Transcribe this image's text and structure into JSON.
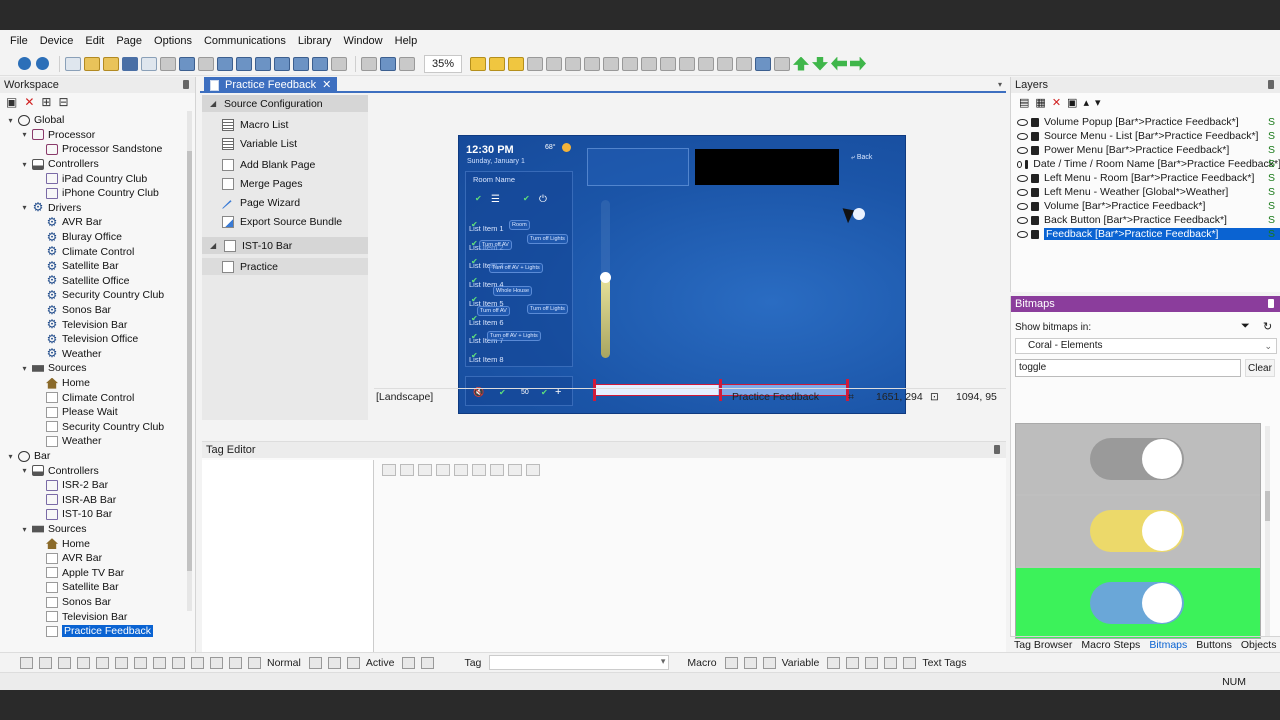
{
  "menu": [
    "File",
    "Device",
    "Edit",
    "Page",
    "Options",
    "Communications",
    "Library",
    "Window",
    "Help"
  ],
  "toolbar": {
    "zoom": "35%"
  },
  "workspace": {
    "title": "Workspace",
    "tree": [
      {
        "label": "Global",
        "icon": "globe",
        "level": 0,
        "tw": "▾"
      },
      {
        "label": "Processor",
        "icon": "proc",
        "level": 1,
        "tw": "▾"
      },
      {
        "label": "Processor Sandstone",
        "icon": "proc",
        "level": 2,
        "tw": ""
      },
      {
        "label": "Controllers",
        "icon": "ctrl",
        "level": 1,
        "tw": "▾"
      },
      {
        "label": "iPad Country Club",
        "icon": "dev",
        "level": 2,
        "tw": ""
      },
      {
        "label": "iPhone Country Club",
        "icon": "dev",
        "level": 2,
        "tw": ""
      },
      {
        "label": "Drivers",
        "icon": "gear",
        "level": 1,
        "tw": "▾"
      },
      {
        "label": "AVR Bar",
        "icon": "gear",
        "level": 2,
        "tw": ""
      },
      {
        "label": "Bluray Office",
        "icon": "gear",
        "level": 2,
        "tw": ""
      },
      {
        "label": "Climate Control",
        "icon": "gear",
        "level": 2,
        "tw": ""
      },
      {
        "label": "Satellite Bar",
        "icon": "gear",
        "level": 2,
        "tw": ""
      },
      {
        "label": "Satellite Office",
        "icon": "gear",
        "level": 2,
        "tw": ""
      },
      {
        "label": "Security Country Club",
        "icon": "gear",
        "level": 2,
        "tw": ""
      },
      {
        "label": "Sonos Bar",
        "icon": "gear",
        "level": 2,
        "tw": ""
      },
      {
        "label": "Television Bar",
        "icon": "gear",
        "level": 2,
        "tw": ""
      },
      {
        "label": "Television Office",
        "icon": "gear",
        "level": 2,
        "tw": ""
      },
      {
        "label": "Weather",
        "icon": "gear",
        "level": 2,
        "tw": ""
      },
      {
        "label": "Sources",
        "icon": "src",
        "level": 1,
        "tw": "▾"
      },
      {
        "label": "Home",
        "icon": "home",
        "level": 2,
        "tw": ""
      },
      {
        "label": "Climate Control",
        "icon": "page",
        "level": 2,
        "tw": ""
      },
      {
        "label": "Please Wait",
        "icon": "page",
        "level": 2,
        "tw": ""
      },
      {
        "label": "Security Country Club",
        "icon": "page",
        "level": 2,
        "tw": ""
      },
      {
        "label": "Weather",
        "icon": "page",
        "level": 2,
        "tw": ""
      },
      {
        "label": "Bar",
        "icon": "bar",
        "level": 0,
        "tw": "▾"
      },
      {
        "label": "Controllers",
        "icon": "ctrl",
        "level": 1,
        "tw": "▾"
      },
      {
        "label": "ISR-2 Bar",
        "icon": "dev",
        "level": 2,
        "tw": ""
      },
      {
        "label": "ISR-AB Bar",
        "icon": "dev",
        "level": 2,
        "tw": ""
      },
      {
        "label": "IST-10 Bar",
        "icon": "dev",
        "level": 2,
        "tw": ""
      },
      {
        "label": "Sources",
        "icon": "src",
        "level": 1,
        "tw": "▾"
      },
      {
        "label": "Home",
        "icon": "home",
        "level": 2,
        "tw": ""
      },
      {
        "label": "AVR Bar",
        "icon": "page",
        "level": 2,
        "tw": ""
      },
      {
        "label": "Apple TV Bar",
        "icon": "page",
        "level": 2,
        "tw": ""
      },
      {
        "label": "Satellite Bar",
        "icon": "page",
        "level": 2,
        "tw": ""
      },
      {
        "label": "Sonos Bar",
        "icon": "page",
        "level": 2,
        "tw": ""
      },
      {
        "label": "Television Bar",
        "icon": "page",
        "level": 2,
        "tw": ""
      },
      {
        "label": "Practice Feedback",
        "icon": "page",
        "level": 2,
        "tw": "",
        "selected": true
      }
    ]
  },
  "doc_tab": {
    "label": "Practice Feedback",
    "close": "✕"
  },
  "page_list": [
    {
      "label": "Source Configuration",
      "type": "group"
    },
    {
      "label": "Macro List",
      "type": "item",
      "icon": "list"
    },
    {
      "label": "Variable List",
      "type": "item",
      "icon": "list"
    },
    {
      "label": "Add Blank Page",
      "type": "item",
      "icon": "doc"
    },
    {
      "label": "Merge Pages",
      "type": "item",
      "icon": "doc"
    },
    {
      "label": "Page Wizard",
      "type": "item",
      "icon": "wand"
    },
    {
      "label": "Export Source Bundle",
      "type": "item",
      "icon": "exp"
    },
    {
      "label": "IST-10 Bar",
      "type": "group"
    },
    {
      "label": "Practice",
      "type": "item",
      "icon": "doc",
      "selected": true
    }
  ],
  "panel": {
    "time": "12:30 PM",
    "date": "Sunday, January 1",
    "temp": "68°",
    "room_name": "Room Name",
    "back": "Back",
    "volume": "50",
    "list_items": [
      "List Item 1",
      "List Item 2",
      "List Item 3",
      "List Item 4",
      "List Item 5",
      "List Item 6",
      "List Item 7",
      "List Item 8"
    ],
    "minis": [
      "Room",
      "Turn off Lights",
      "Turn off AV",
      "Turn off AV + Lights",
      "Whole House",
      "Turn off AV",
      "Turn off Lights",
      "Turn off AV + Lights"
    ]
  },
  "canvas_status": {
    "orientation": "[Landscape]",
    "page": "Practice Feedback",
    "pos": "1651, 294",
    "size": "1094, 95"
  },
  "tag_editor": {
    "title": "Tag Editor"
  },
  "layers": {
    "title": "Layers",
    "items": [
      {
        "label": "Volume Popup [Bar*>Practice Feedback*]"
      },
      {
        "label": "Source Menu - List [Bar*>Practice Feedback*]"
      },
      {
        "label": "Power Menu [Bar*>Practice Feedback*]"
      },
      {
        "label": "Date / Time / Room Name [Bar*>Practice Feedback*]"
      },
      {
        "label": "Left Menu - Room [Bar*>Practice Feedback*]"
      },
      {
        "label": "Left Menu - Weather [Global*>Weather]"
      },
      {
        "label": "Volume [Bar*>Practice Feedback*]"
      },
      {
        "label": "Back Button [Bar*>Practice Feedback*]"
      },
      {
        "label": "Feedback [Bar*>Practice Feedback*]",
        "selected": true
      }
    ],
    "s_flag": "S"
  },
  "bitmaps": {
    "title": "Bitmaps",
    "show_label": "Show bitmaps in:",
    "source": "Coral - Elements",
    "search_value": "toggle",
    "clear": "Clear",
    "swatches": [
      {
        "bg": "#bdbdbd",
        "track": "#9a9a9a"
      },
      {
        "bg": "#bdbdbd",
        "track": "#ecd96a"
      },
      {
        "bg": "#3cf25a",
        "track": "#6aa7d8"
      }
    ]
  },
  "right_tabs": [
    "Tag Browser",
    "Macro Steps",
    "Bitmaps",
    "Buttons",
    "Objects"
  ],
  "bottom_toolbar": {
    "normal": "Normal",
    "active": "Active",
    "tag": "Tag",
    "macro": "Macro",
    "variable": "Variable",
    "text_tags": "Text Tags"
  },
  "status_bar": {
    "num": "NUM"
  }
}
